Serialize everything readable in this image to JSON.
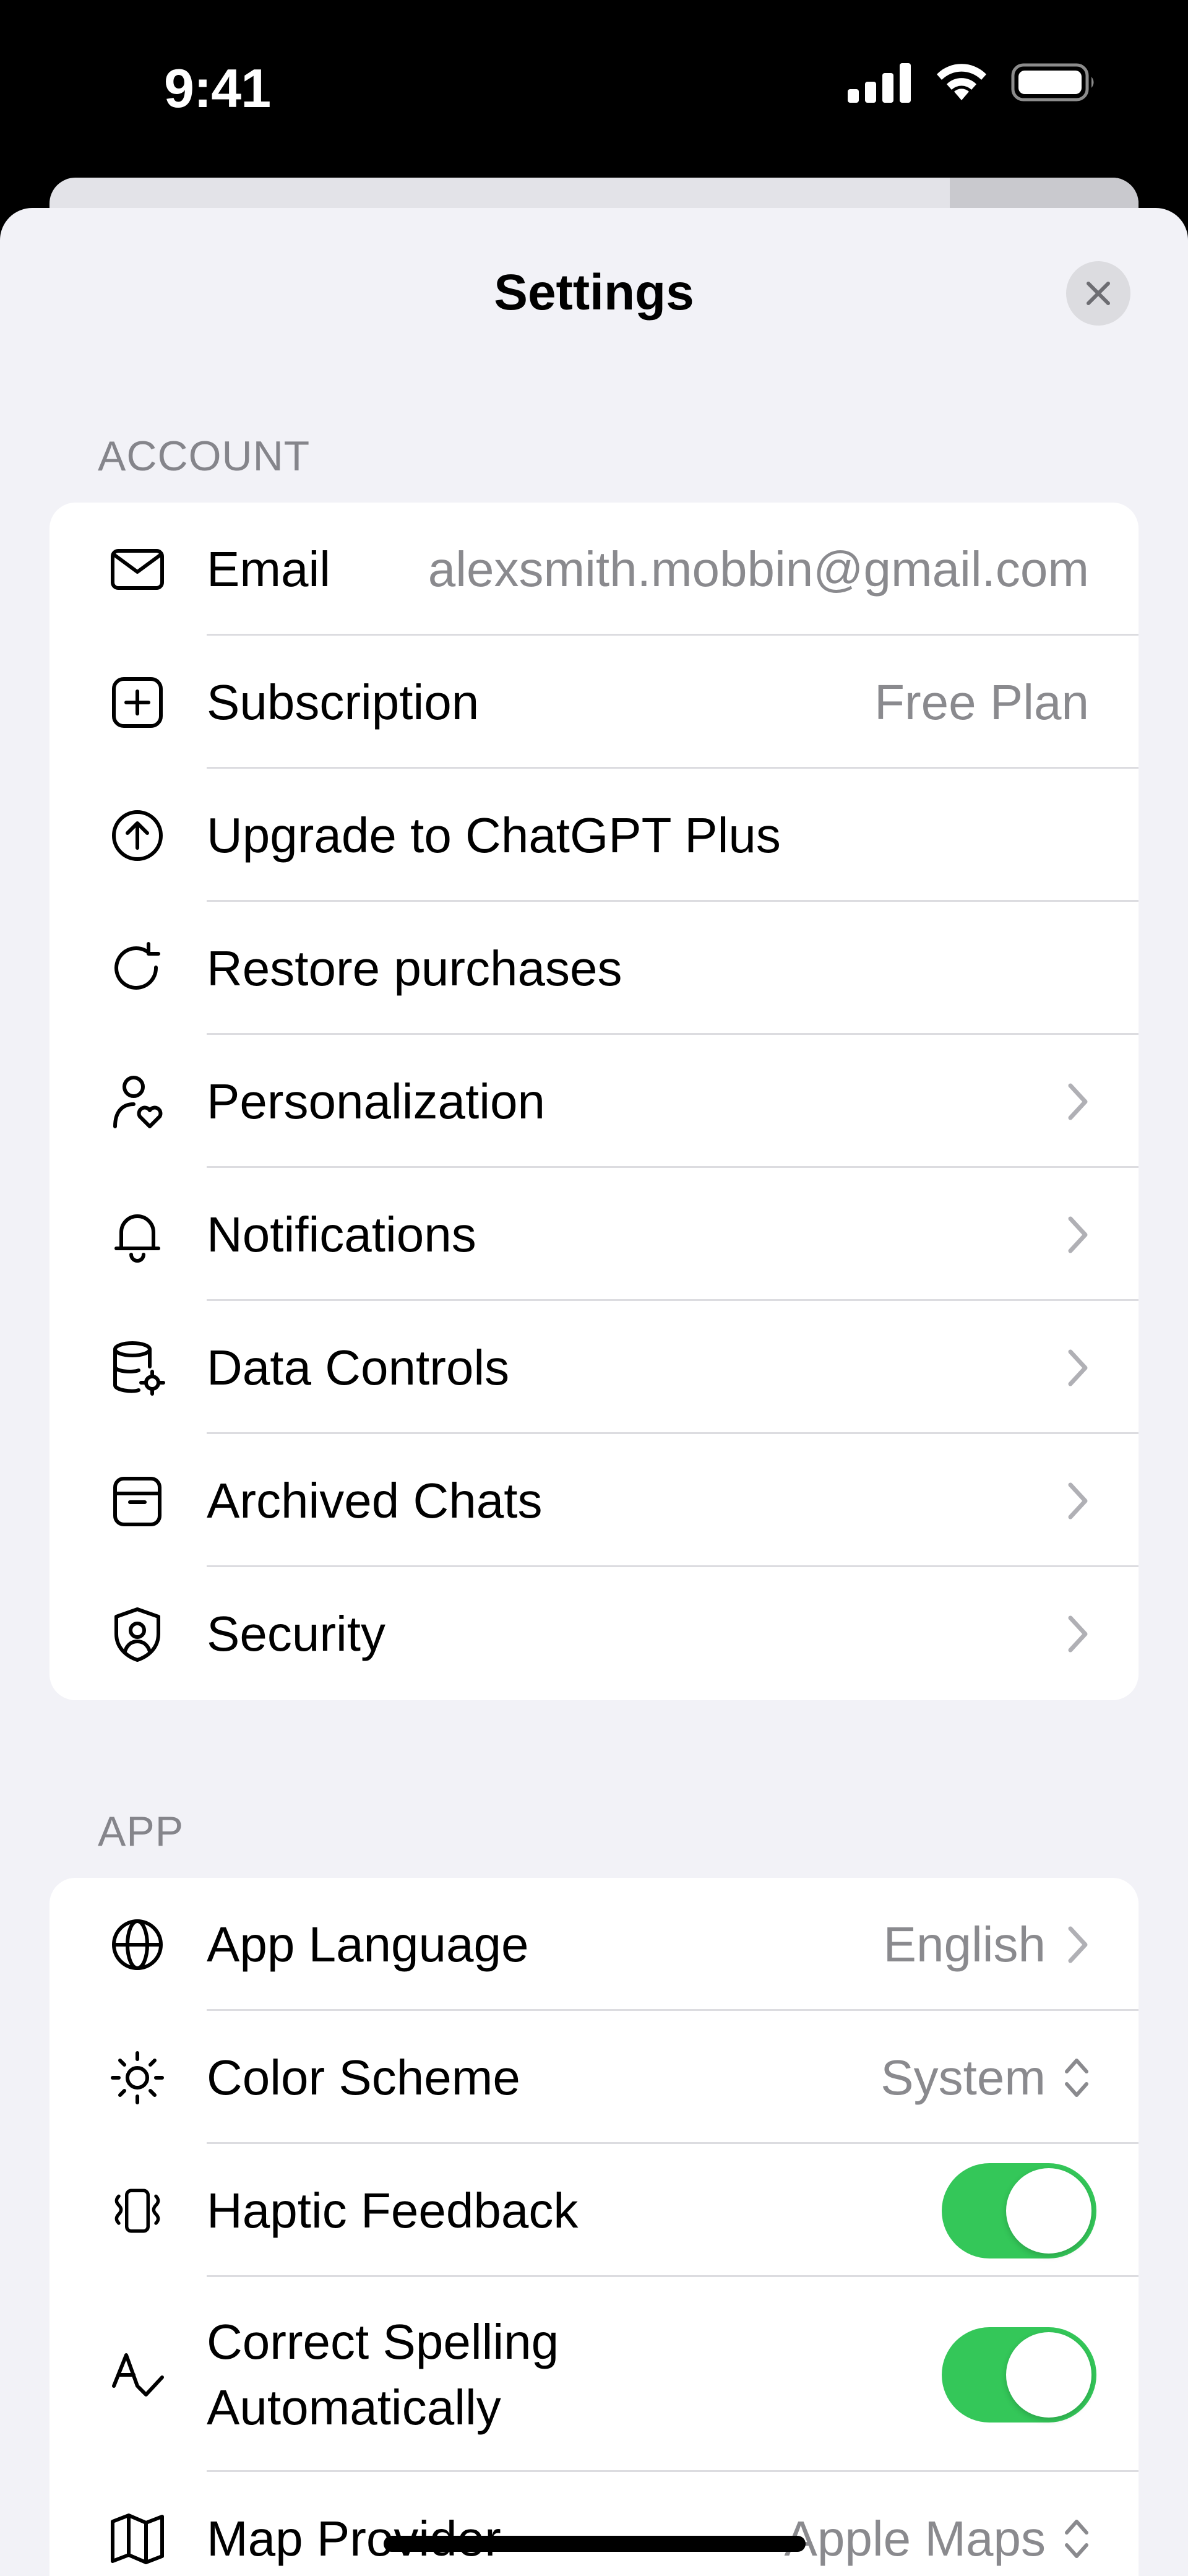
{
  "status_bar": {
    "time": "9:41"
  },
  "sheet": {
    "title": "Settings"
  },
  "account": {
    "header": "ACCOUNT",
    "rows": [
      {
        "icon": "mail-icon",
        "label": "Email",
        "value": "alexsmith.mobbin@gmail.com"
      },
      {
        "icon": "plus-square-icon",
        "label": "Subscription",
        "value": "Free Plan"
      },
      {
        "icon": "arrow-up-circle-icon",
        "label": "Upgrade to ChatGPT Plus"
      },
      {
        "icon": "refresh-icon",
        "label": "Restore purchases"
      },
      {
        "icon": "person-heart-icon",
        "label": "Personalization"
      },
      {
        "icon": "bell-icon",
        "label": "Notifications"
      },
      {
        "icon": "database-gear-icon",
        "label": "Data Controls"
      },
      {
        "icon": "archive-icon",
        "label": "Archived Chats"
      },
      {
        "icon": "shield-user-icon",
        "label": "Security"
      }
    ]
  },
  "app": {
    "header": "APP",
    "rows": [
      {
        "icon": "globe-icon",
        "label": "App Language",
        "value": "English"
      },
      {
        "icon": "sun-icon",
        "label": "Color Scheme",
        "value": "System"
      },
      {
        "icon": "haptic-icon",
        "label": "Haptic Feedback",
        "toggle_on": true
      },
      {
        "icon": "spellcheck-icon",
        "label_line1": "Correct Spelling",
        "label_line2": "Automatically",
        "toggle_on": true
      },
      {
        "icon": "map-icon",
        "label": "Map Provider",
        "value": "Apple Maps"
      }
    ]
  },
  "colors": {
    "accent_toggle": "#34c759",
    "sheet_bg": "#f2f2f7",
    "secondary_text": "#8a8a8e"
  }
}
